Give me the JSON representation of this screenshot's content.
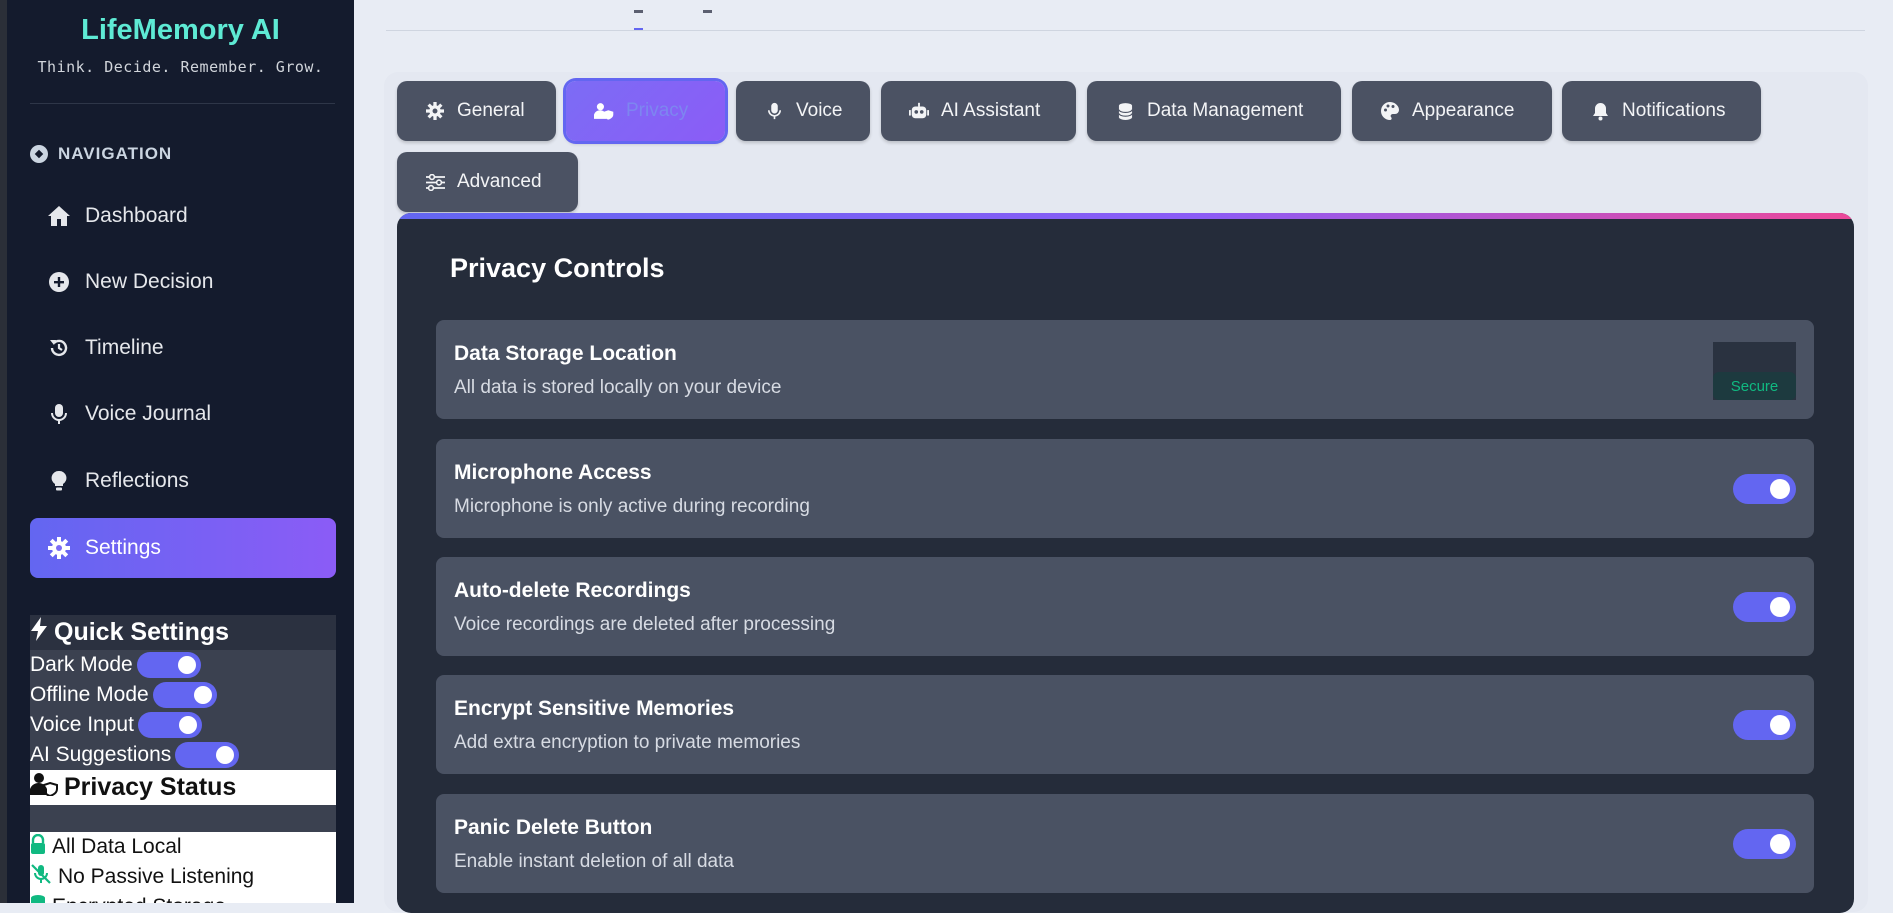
{
  "brand": {
    "title": "LifeMemory AI",
    "tagline": "Think. Decide. Remember. Grow."
  },
  "navigation": {
    "heading": "NAVIGATION",
    "items": [
      {
        "label": "Dashboard",
        "icon": "home-icon"
      },
      {
        "label": "New Decision",
        "icon": "plus-circle-icon"
      },
      {
        "label": "Timeline",
        "icon": "history-icon"
      },
      {
        "label": "Voice Journal",
        "icon": "microphone-icon"
      },
      {
        "label": "Reflections",
        "icon": "lightbulb-icon"
      },
      {
        "label": "Settings",
        "icon": "gear-icon",
        "active": true
      }
    ]
  },
  "quick_settings": {
    "heading": "Quick Settings",
    "items": [
      {
        "label": "Dark Mode",
        "on": true
      },
      {
        "label": "Offline Mode",
        "on": true
      },
      {
        "label": "Voice Input",
        "on": true
      },
      {
        "label": "AI Suggestions",
        "on": true
      }
    ]
  },
  "privacy_status": {
    "heading": "Privacy Status",
    "items": [
      {
        "label": "All Data Local",
        "icon": "lock-icon"
      },
      {
        "label": "No Passive Listening",
        "icon": "microphone-slash-icon"
      },
      {
        "label": "Encrypted Storage",
        "icon": "database-icon"
      }
    ]
  },
  "tabs": [
    {
      "label": "General",
      "icon": "gear-icon"
    },
    {
      "label": "Privacy",
      "icon": "user-shield-icon",
      "active": true
    },
    {
      "label": "Voice",
      "icon": "microphone-icon"
    },
    {
      "label": "AI Assistant",
      "icon": "robot-icon"
    },
    {
      "label": "Data Management",
      "icon": "database-icon"
    },
    {
      "label": "Appearance",
      "icon": "palette-icon"
    },
    {
      "label": "Notifications",
      "icon": "bell-icon"
    },
    {
      "label": "Advanced",
      "icon": "sliders-icon"
    }
  ],
  "privacy_controls": {
    "title": "Privacy Controls",
    "items": [
      {
        "title": "Data Storage Location",
        "desc": "All data is stored locally on your device",
        "badge": "Secure"
      },
      {
        "title": "Microphone Access",
        "desc": "Microphone is only active during recording",
        "on": true
      },
      {
        "title": "Auto-delete Recordings",
        "desc": "Voice recordings are deleted after processing",
        "on": true
      },
      {
        "title": "Encrypt Sensitive Memories",
        "desc": "Add extra encryption to private memories",
        "on": true
      },
      {
        "title": "Panic Delete Button",
        "desc": "Enable instant deletion of all data",
        "on": true
      }
    ]
  },
  "colors": {
    "accent": "#6366f1",
    "accent2": "#8b5cf6",
    "brand": "#5eead4",
    "secure": "#10b981"
  }
}
